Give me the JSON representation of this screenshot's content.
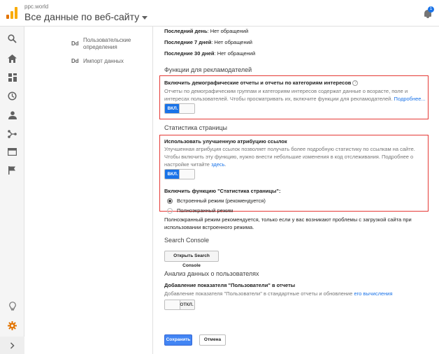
{
  "header": {
    "account": "ppc.world",
    "property": "Все данные по веб-сайту",
    "notification_count": "1"
  },
  "admin_column": {
    "items": [
      {
        "prefix": "Dd",
        "label": "Пользовательские определения"
      },
      {
        "prefix": "Dd",
        "label": "Импорт данных"
      }
    ]
  },
  "last_requests": {
    "day_label": "Последний день",
    "day_value": ": Нет обращений",
    "week_label": "Последние 7 дней",
    "week_value": ": Нет обращений",
    "month_label": "Последние 30 дней",
    "month_value": ": Нет обращений"
  },
  "advertiser_features": {
    "section_title": "Функции для рекламодателей",
    "setting_title": "Включить демографические отчеты и отчеты по категориям интересов",
    "description": "Отчеты по демографическим группам и категориям интересов содержат данные о возрасте, поле и интересах пользователей. Чтобы просматривать их, включите функции для рекламодателей.",
    "more_link": "Подробнее...",
    "toggle_label": "ВКЛ.",
    "toggle_state": "on"
  },
  "page_analytics": {
    "section_title": "Статистика страницы",
    "setting_title": "Использовать улучшенную атрибуцию ссылок",
    "description": "Улучшенная атрибуция ссылок позволяет получать более подробную статистику по ссылкам на сайте. Чтобы включить эту функцию, нужно внести небольшие изменения в код отслеживания. Подробнее о настройке читайте",
    "here_link": "здесь",
    "toggle_label": "ВКЛ.",
    "toggle_state": "on",
    "enable_label": "Включить функцию \"Статистика страницы\":",
    "options": [
      {
        "label": "Встроенный режим (рекомендуется)",
        "checked": true
      },
      {
        "label": "Полноэкранный режим",
        "checked": false
      }
    ],
    "fullscreen_note": "Полноэкранный режим рекомендуется, только если у вас возникают проблемы с загрузкой сайта при использовании встроенного режима."
  },
  "search_console": {
    "section_title": "Search Console",
    "button_label": "Открыть Search Console"
  },
  "user_analysis": {
    "section_title": "Анализ данных о пользователях",
    "setting_title": "Добавление показателя \"Пользователи\" в отчеты",
    "description": "Добавление показателя \"Пользователи\" в стандартные отчеты и обновление",
    "link": "его вычисления",
    "toggle_label": "ОТКЛ.",
    "toggle_state": "off"
  },
  "actions": {
    "save_label": "Сохранить",
    "cancel_label": "Отмена"
  },
  "colors": {
    "accent": "#1a73e8",
    "highlight_border": "#e53935",
    "brand_orange": "#f9ab00"
  },
  "icons": {
    "rail": [
      "search-icon",
      "home-icon",
      "customization-icon",
      "clock-icon",
      "person-icon",
      "acquisition-icon",
      "behavior-icon",
      "flag-icon",
      "lightbulb-icon",
      "gear-icon",
      "chevron-right-icon"
    ]
  }
}
